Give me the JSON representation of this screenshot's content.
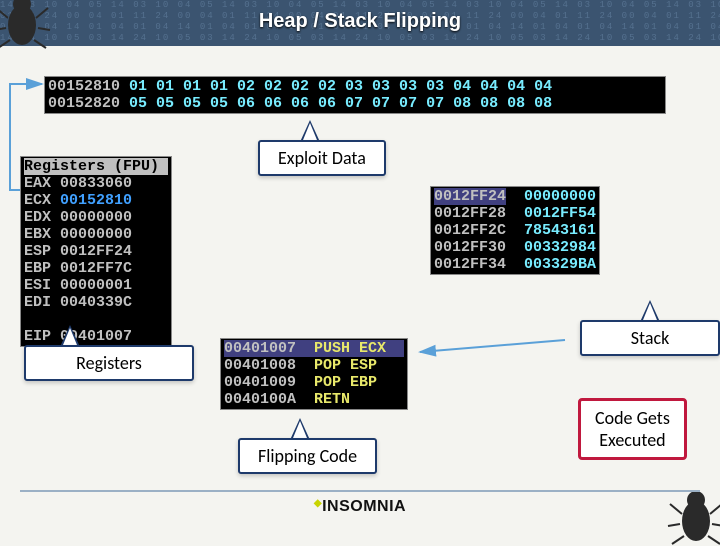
{
  "title": "Heap / Stack Flipping",
  "footer": "INSOMNIA",
  "labels": {
    "exploit_data": "Exploit Data",
    "registers": "Registers",
    "stack": "Stack",
    "flipping_code": "Flipping Code",
    "code_executed": "Code Gets\nExecuted"
  },
  "memory_dump": {
    "line1_addr": "00152810",
    "line1_bytes": " 01 01 01 01 02 02 02 02 03 03 03 03 04 04 04 04",
    "line2_addr": "00152820",
    "line2_bytes": " 05 05 05 05 06 06 06 06 07 07 07 07 08 08 08 08"
  },
  "registers_window": {
    "header": "Registers (FPU)",
    "rows": [
      "EAX 00833060",
      "ECX 00152810",
      "EDX 00000000",
      "EBX 00000000",
      "ESP 0012FF24",
      "EBP 0012FF7C",
      "ESI 00000001",
      "EDI 0040339C",
      "",
      "EIP 00401007"
    ],
    "highlight_index": 1
  },
  "stack_window": {
    "rows": [
      {
        "addr": "0012FF24",
        "val": "00000000",
        "hl": true
      },
      {
        "addr": "0012FF28",
        "val": "0012FF54",
        "hl": false
      },
      {
        "addr": "0012FF2C",
        "val": "78543161",
        "hl": false
      },
      {
        "addr": "0012FF30",
        "val": "00332984",
        "hl": false
      },
      {
        "addr": "0012FF34",
        "val": "003329BA",
        "hl": false
      }
    ]
  },
  "disasm": {
    "rows": [
      {
        "addr": "00401007",
        "ins": "PUSH ECX",
        "hl": true
      },
      {
        "addr": "00401008",
        "ins": "POP ESP",
        "hl": false
      },
      {
        "addr": "00401009",
        "ins": "POP EBP",
        "hl": false
      },
      {
        "addr": "0040100A",
        "ins": "RETN",
        "hl": false
      }
    ]
  }
}
